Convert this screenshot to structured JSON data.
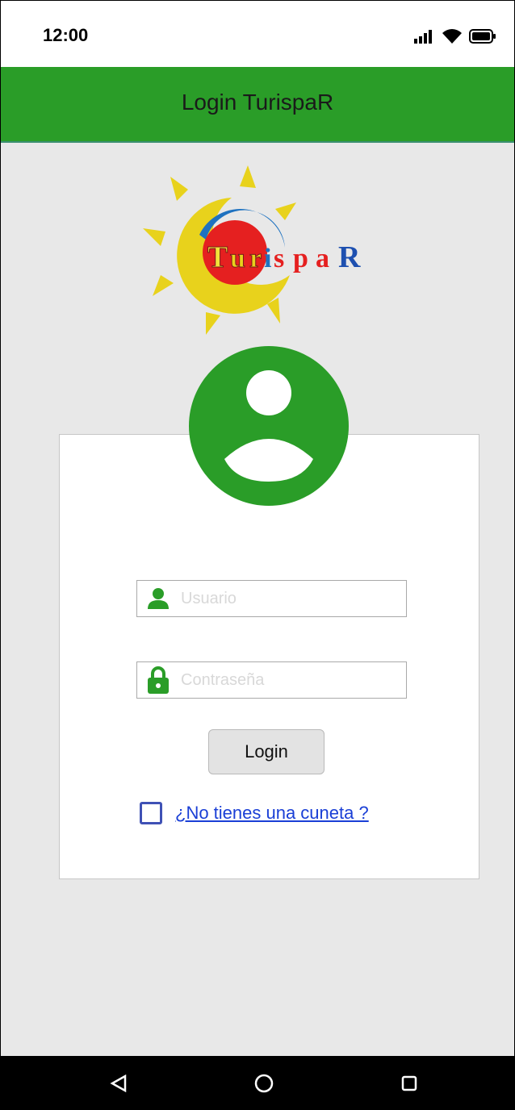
{
  "status_bar": {
    "time": "12:00"
  },
  "app_bar": {
    "title": "Login TurispaR"
  },
  "logo": {
    "text": "TurispaR"
  },
  "form": {
    "username_placeholder": "Usuario",
    "password_placeholder": "Contraseña",
    "login_label": "Login",
    "register_link": "¿No tienes una cuneta ?"
  },
  "colors": {
    "primary_green": "#2a9d28",
    "checkbox_blue": "#3f51b5",
    "link_blue": "#1a3fd6"
  },
  "icons": {
    "status": [
      "signal-icon",
      "wifi-icon",
      "battery-icon"
    ],
    "fields": [
      "person-icon",
      "lock-icon"
    ],
    "nav": [
      "back-icon",
      "home-icon",
      "recents-icon"
    ]
  }
}
